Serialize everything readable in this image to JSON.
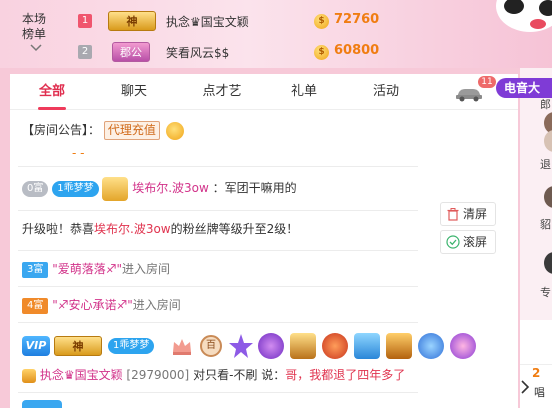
{
  "rank": {
    "title_line1": "本场",
    "title_line2": "榜单",
    "rows": [
      {
        "num": "1",
        "badge": "神",
        "name": "执念♛国宝文颖",
        "score": "72760"
      },
      {
        "num": "2",
        "badge": "郡公",
        "name": "笑看风云$$",
        "score": "60800"
      }
    ]
  },
  "tabs": [
    "全部",
    "聊天",
    "点才艺",
    "礼单",
    "活动"
  ],
  "car_count": "11",
  "music_label": "电音大",
  "announcement": {
    "label": "【房间公告】：",
    "tag": "代理充值",
    "dashes": "- -"
  },
  "msg_fans": {
    "rich_level": "0富",
    "fan_badge": "1乖梦梦",
    "user": "埃布尔.波3ow",
    "text": "：军团干嘛用的"
  },
  "msg_upgrade": {
    "prefix": "升级啦！恭喜",
    "user": "埃布尔.波3ow",
    "suffix": "的粉丝牌等级升至2级！"
  },
  "buttons": {
    "clear": "清屏",
    "scroll": "滚屏"
  },
  "msg_enter1": {
    "level": "3富",
    "user": "\"爱萌落落♐\"",
    "text": "进入房间"
  },
  "msg_enter2": {
    "level": "4富",
    "user": "\"♐安心承诺♐\"",
    "text": "进入房间"
  },
  "badges_row": {
    "vip": "VIP",
    "god": "神",
    "fan": "1乖梦梦",
    "hundred": "百"
  },
  "msg_chat": {
    "user": "执念♛国宝文颖",
    "uid": "[2979000]",
    "mid": "对只看-不刷",
    "say": "说：",
    "text": "哥，我都退了四年多了"
  },
  "side": {
    "labels": [
      "郎",
      "退",
      "貂",
      "专"
    ],
    "bottom_num": "2",
    "bottom_text": "唱"
  },
  "colors": {
    "accent": "#e02d4e",
    "score": "#f07d12",
    "music": "#7f3bd6"
  }
}
